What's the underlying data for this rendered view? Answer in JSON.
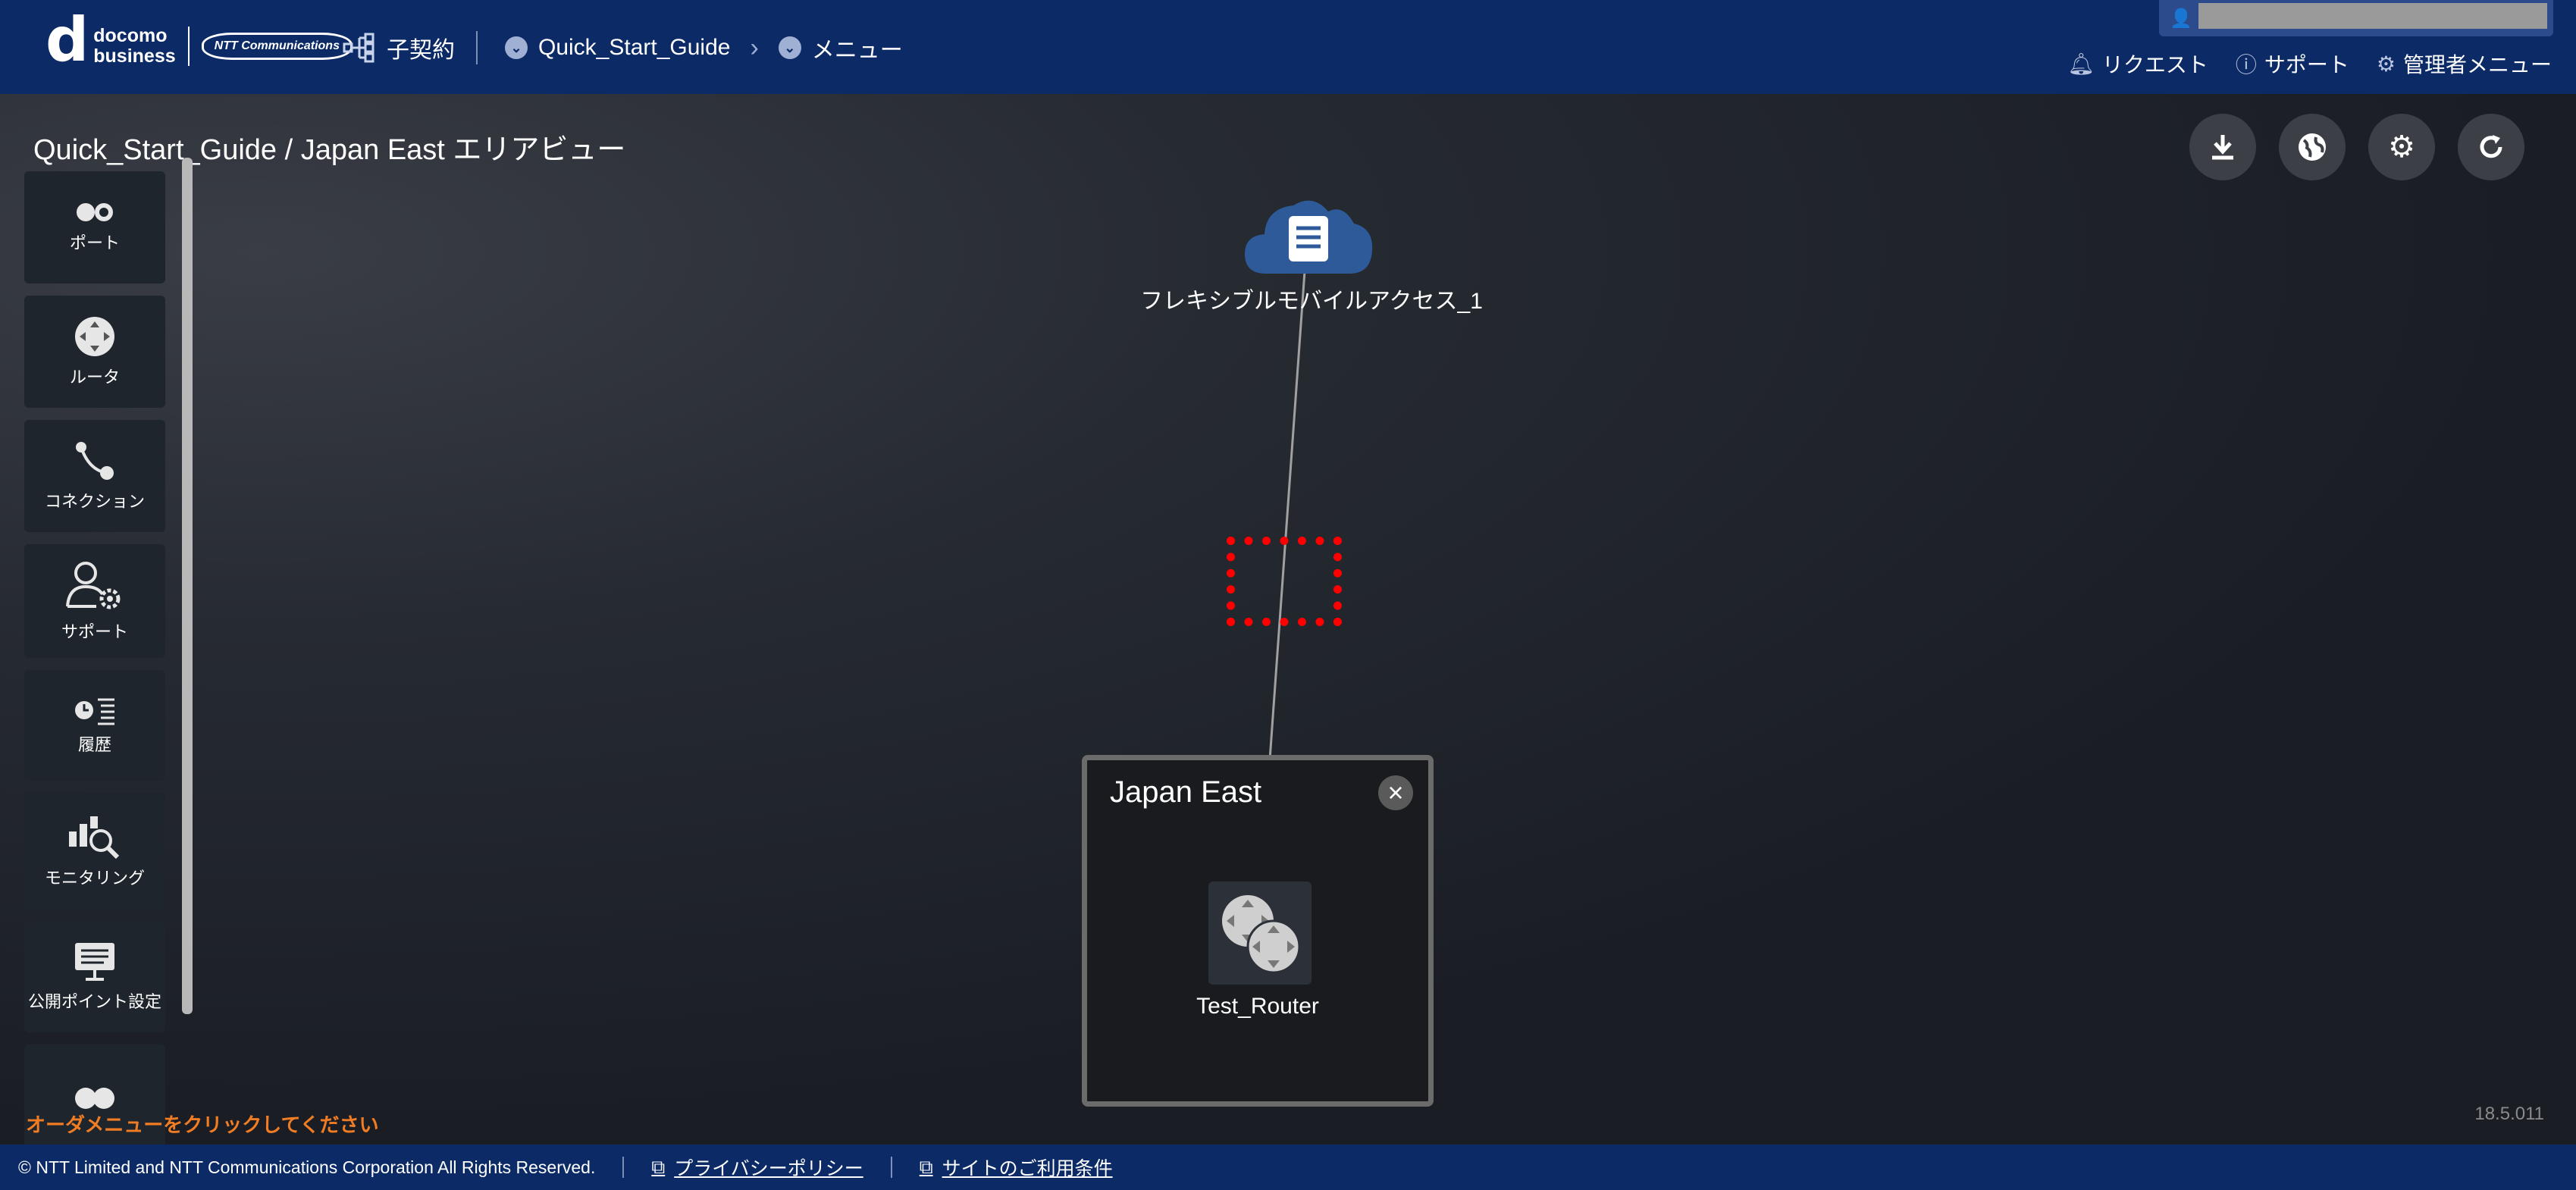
{
  "header": {
    "brand_top": "docomo",
    "brand_bottom": "business",
    "partner_logo": "NTT Communications",
    "contract_label": "子契約",
    "breadcrumb": [
      "Quick_Start_Guide",
      "メニュー"
    ],
    "links": [
      {
        "label": "リクエスト",
        "icon": "bell-icon"
      },
      {
        "label": "サポート",
        "icon": "help-circle-icon"
      },
      {
        "label": "管理者メニュー",
        "icon": "gear-icon"
      }
    ]
  },
  "page": {
    "title": "Quick_Start_Guide / Japan East エリアビュー",
    "order_message": "オーダメニューをクリックしてください",
    "version": "18.5.011"
  },
  "sidebar": {
    "items": [
      {
        "label": "ポート",
        "icon": "port-icon"
      },
      {
        "label": "ルータ",
        "icon": "router-icon"
      },
      {
        "label": "コネクション",
        "icon": "connection-icon"
      },
      {
        "label": "サポート",
        "icon": "user-gear-icon"
      },
      {
        "label": "履歴",
        "icon": "history-icon"
      },
      {
        "label": "モニタリング",
        "icon": "monitoring-icon"
      },
      {
        "label": "公開ポイント設定",
        "icon": "display-icon"
      }
    ]
  },
  "canvas": {
    "cloud_label": "フレキシブルモバイルアクセス_1",
    "region_title": "Japan East",
    "router_label": "Test_Router"
  },
  "footer": {
    "copyright": "© NTT Limited and NTT Communications Corporation All Rights Reserved.",
    "privacy": "プライバシーポリシー",
    "terms": "サイトのご利用条件"
  }
}
